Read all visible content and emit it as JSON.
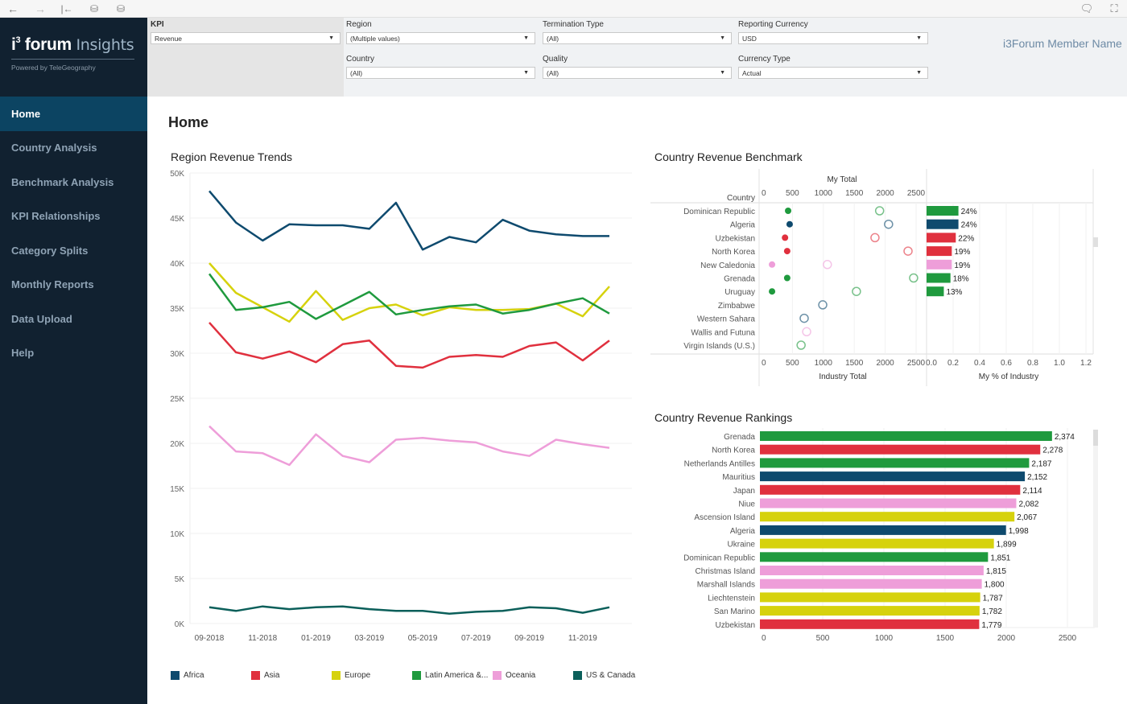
{
  "toolbar": {
    "buttons": [
      {
        "name": "back-icon",
        "glyph": "←"
      },
      {
        "name": "forward-icon",
        "glyph": "→"
      },
      {
        "name": "revert-icon",
        "glyph": "|←"
      },
      {
        "name": "refresh-data-icon",
        "glyph": "⛁"
      },
      {
        "name": "pause-updates-icon",
        "glyph": "⛁"
      }
    ],
    "comment_glyph": "🗨",
    "fullscreen_glyph": "⛶"
  },
  "logo": {
    "brand_prefix": "i",
    "brand_sup": "3",
    "brand_main": " forum ",
    "brand_accent": "Insights",
    "tagline": "Powered by TeleGeography"
  },
  "sidebar": {
    "items": [
      {
        "label": "Home",
        "active": true
      },
      {
        "label": "Country Analysis",
        "active": false
      },
      {
        "label": "Benchmark Analysis",
        "active": false
      },
      {
        "label": "KPI Relationships",
        "active": false
      },
      {
        "label": "Category Splits",
        "active": false
      },
      {
        "label": "Monthly Reports",
        "active": false
      },
      {
        "label": "Data Upload",
        "active": false
      },
      {
        "label": "Help",
        "active": false
      }
    ]
  },
  "filters": {
    "kpi": {
      "label": "KPI",
      "value": "Revenue"
    },
    "region": {
      "label": "Region",
      "value": "(Multiple values)"
    },
    "termination_type": {
      "label": "Termination Type",
      "value": "(All)"
    },
    "reporting_currency": {
      "label": "Reporting Currency",
      "value": "USD"
    },
    "country": {
      "label": "Country",
      "value": "(All)"
    },
    "quality": {
      "label": "Quality",
      "value": "(All)"
    },
    "currency_type": {
      "label": "Currency Type",
      "value": "Actual"
    },
    "caret": "▼"
  },
  "member_name": "i3Forum Member Name",
  "page_title": "Home",
  "colors": {
    "Africa": "#0e4a6e",
    "Asia": "#e0303e",
    "Europe": "#d6d20d",
    "Latin America & Caribbean": "#1f9a3e",
    "Oceania": "#ee9ed9",
    "US & Canada": "#0b5f5a"
  },
  "chart_data": [
    {
      "type": "line",
      "title": "Region Revenue Trends",
      "xlabel": "",
      "ylabel": "",
      "x": [
        "09-2018",
        "10-2018",
        "11-2018",
        "12-2018",
        "01-2019",
        "02-2019",
        "03-2019",
        "04-2019",
        "05-2019",
        "06-2019",
        "07-2019",
        "08-2019",
        "09-2019",
        "10-2019",
        "11-2019",
        "12-2019"
      ],
      "x_tick_labels": [
        "09-2018",
        "11-2018",
        "01-2019",
        "03-2019",
        "05-2019",
        "07-2019",
        "09-2019",
        "11-2019"
      ],
      "ylim": [
        0,
        50000
      ],
      "y_ticks": [
        0,
        5000,
        10000,
        15000,
        20000,
        25000,
        30000,
        35000,
        40000,
        45000,
        50000
      ],
      "y_tick_labels": [
        "0K",
        "5K",
        "10K",
        "15K",
        "20K",
        "25K",
        "30K",
        "35K",
        "40K",
        "45K",
        "50K"
      ],
      "grid": true,
      "legend_position": "bottom",
      "series": [
        {
          "name": "Africa",
          "legend_label": "Africa",
          "values": [
            48000,
            44500,
            42500,
            44300,
            44200,
            44200,
            43800,
            46700,
            41500,
            42900,
            42300,
            44800,
            43600,
            43200,
            43000,
            43000
          ]
        },
        {
          "name": "Asia",
          "legend_label": "Asia",
          "values": [
            33400,
            30100,
            29400,
            30200,
            29000,
            31000,
            31400,
            28600,
            28400,
            29600,
            29800,
            29600,
            30800,
            31200,
            29200,
            31400
          ]
        },
        {
          "name": "Europe",
          "legend_label": "Europe",
          "values": [
            40000,
            36700,
            35100,
            33500,
            36900,
            33700,
            35000,
            35400,
            34200,
            35100,
            34800,
            34800,
            34900,
            35500,
            34100,
            37400
          ]
        },
        {
          "name": "Latin America & Caribbean",
          "legend_label": "Latin America &...",
          "values": [
            38800,
            34800,
            35100,
            35700,
            33800,
            35300,
            36800,
            34300,
            34800,
            35200,
            35400,
            34400,
            34800,
            35500,
            36100,
            34400
          ]
        },
        {
          "name": "Oceania",
          "legend_label": "Oceania",
          "values": [
            21900,
            19100,
            18900,
            17600,
            21000,
            18600,
            17900,
            20400,
            20600,
            20300,
            20100,
            19100,
            18600,
            20400,
            19900,
            19500
          ]
        },
        {
          "name": "US & Canada",
          "legend_label": "US & Canada",
          "values": [
            1800,
            1400,
            1900,
            1600,
            1800,
            1900,
            1600,
            1400,
            1400,
            1100,
            1300,
            1400,
            1800,
            1700,
            1200,
            1800
          ]
        }
      ]
    },
    {
      "type": "scatter",
      "title": "Country Revenue Benchmark",
      "row_header": "Country",
      "top_axis_label": "My Total",
      "bottom_axis_label": "Industry Total",
      "xlim": [
        0,
        2700
      ],
      "x_ticks": [
        0,
        500,
        1000,
        1500,
        2000,
        2500
      ],
      "pct_axis_label": "My % of Industry",
      "pct_xlim": [
        0,
        1.25
      ],
      "pct_ticks": [
        "0.0",
        "0.2",
        "0.4",
        "0.6",
        "0.8",
        "1.0",
        "1.2"
      ],
      "rows": [
        {
          "country": "Dominican Republic",
          "region": "Latin America & Caribbean",
          "my_total": 430,
          "industry_total": 1910,
          "pct": 0.24,
          "pct_label": "24%"
        },
        {
          "country": "Algeria",
          "region": "Africa",
          "my_total": 455,
          "industry_total": 2055,
          "pct": 0.24,
          "pct_label": "24%"
        },
        {
          "country": "Uzbekistan",
          "region": "Asia",
          "my_total": 380,
          "industry_total": 1835,
          "pct": 0.22,
          "pct_label": "22%"
        },
        {
          "country": "North Korea",
          "region": "Asia",
          "my_total": 415,
          "industry_total": 2370,
          "pct": 0.19,
          "pct_label": "19%"
        },
        {
          "country": "New Caledonia",
          "region": "Oceania",
          "my_total": 170,
          "industry_total": 1065,
          "pct": 0.19,
          "pct_label": "19%"
        },
        {
          "country": "Grenada",
          "region": "Latin America & Caribbean",
          "my_total": 415,
          "industry_total": 2460,
          "pct": 0.18,
          "pct_label": "18%"
        },
        {
          "country": "Uruguay",
          "region": "Latin America & Caribbean",
          "my_total": 170,
          "industry_total": 1535,
          "pct": 0.13,
          "pct_label": "13%"
        },
        {
          "country": "Zimbabwe",
          "region": "Africa",
          "my_total": null,
          "industry_total": 990,
          "pct": null,
          "pct_label": ""
        },
        {
          "country": "Western Sahara",
          "region": "Africa",
          "my_total": null,
          "industry_total": 690,
          "pct": null,
          "pct_label": ""
        },
        {
          "country": "Wallis and Futuna",
          "region": "Oceania",
          "my_total": null,
          "industry_total": 730,
          "pct": null,
          "pct_label": ""
        },
        {
          "country": "Virgin Islands (U.S.)",
          "region": "Latin America & Caribbean",
          "my_total": null,
          "industry_total": 640,
          "pct": null,
          "pct_label": ""
        }
      ]
    },
    {
      "type": "bar",
      "orientation": "horizontal",
      "title": "Country Revenue Rankings",
      "xlim": [
        0,
        2700
      ],
      "x_ticks": [
        0,
        500,
        1000,
        1500,
        2000,
        2500
      ],
      "categories": [
        "Grenada",
        "North Korea",
        "Netherlands Antilles",
        "Mauritius",
        "Japan",
        "Niue",
        "Ascension Island",
        "Algeria",
        "Ukraine",
        "Dominican Republic",
        "Christmas Island",
        "Marshall Islands",
        "Liechtenstein",
        "San Marino",
        "Uzbekistan"
      ],
      "values": [
        2374,
        2278,
        2187,
        2152,
        2114,
        2082,
        2067,
        1998,
        1899,
        1851,
        1815,
        1800,
        1787,
        1782,
        1779
      ],
      "value_labels": [
        "2,374",
        "2,278",
        "2,187",
        "2,152",
        "2,114",
        "2,082",
        "2,067",
        "1,998",
        "1,899",
        "1,851",
        "1,815",
        "1,800",
        "1,787",
        "1,782",
        "1,779"
      ],
      "regions": [
        "Latin America & Caribbean",
        "Asia",
        "Latin America & Caribbean",
        "Africa",
        "Asia",
        "Oceania",
        "Europe",
        "Africa",
        "Europe",
        "Latin America & Caribbean",
        "Oceania",
        "Oceania",
        "Europe",
        "Europe",
        "Asia"
      ]
    }
  ]
}
